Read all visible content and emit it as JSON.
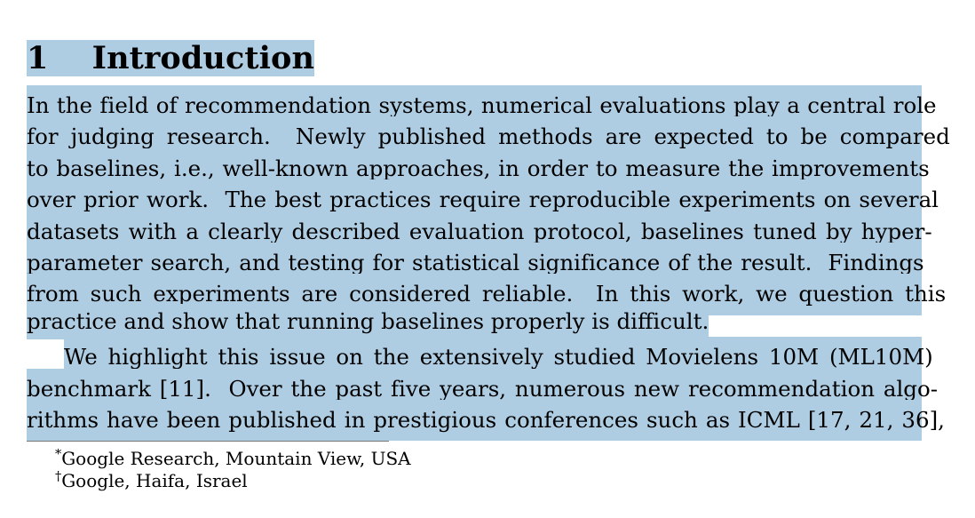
{
  "document": {
    "type": "academic-paper-page",
    "highlight_color": "#aecde3",
    "text_color": "#000000",
    "background_color": "#ffffff"
  },
  "heading": {
    "number": "1",
    "title": "Introduction",
    "full": "1    Introduction",
    "highlighted": true
  },
  "paragraphs": [
    {
      "id": "intro-paragraph-1",
      "indent": false,
      "highlighted": true,
      "lines": [
        "In the field of recommendation systems, numerical evaluations play a central role",
        "for judging research.  Newly published methods are expected to be compared",
        "to baselines, i.e., well-known approaches, in order to measure the improvements",
        "over prior work.  The best practices require reproducible experiments on several",
        "datasets with a clearly described evaluation protocol, baselines tuned by hyper-",
        "parameter search, and testing for statistical significance of the result.  Findings",
        "from such experiments are considered reliable.  In this work, we question this",
        "practice and show that running baselines properly is difficult."
      ],
      "text": "In the field of recommendation systems, numerical evaluations play a central role for judging research. Newly published methods are expected to be compared to baselines, i.e., well-known approaches, in order to measure the improvements over prior work. The best practices require reproducible experiments on several datasets with a clearly described evaluation protocol, baselines tuned by hyper-parameter search, and testing for statistical significance of the result. Findings from such experiments are considered reliable. In this work, we question this practice and show that running baselines properly is difficult."
    },
    {
      "id": "intro-paragraph-2",
      "indent": true,
      "highlighted": true,
      "lines": [
        "We highlight this issue on the extensively studied Movielens 10M (ML10M)",
        "benchmark [11].  Over the past five years, numerous new recommendation algo-",
        "rithms have been published in prestigious conferences such as ICML [17, 21, 36],"
      ],
      "text": "We highlight this issue on the extensively studied Movielens 10M (ML10M) benchmark [11]. Over the past five years, numerous new recommendation algorithms have been published in prestigious conferences such as ICML [17, 21, 36],"
    }
  ],
  "footnotes": {
    "rule_visible": true,
    "items": [
      {
        "marker": "*",
        "text": "Google Research, Mountain View, USA"
      },
      {
        "marker": "†",
        "text": "Google, Haifa, Israel"
      }
    ]
  }
}
